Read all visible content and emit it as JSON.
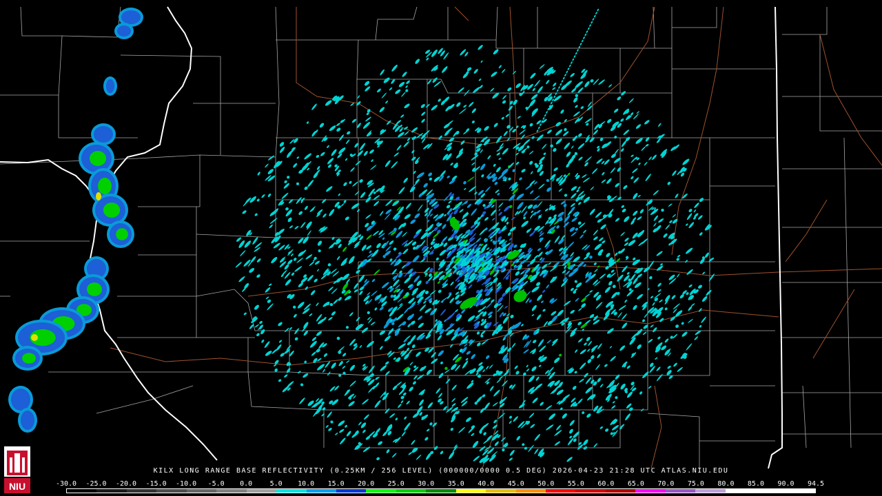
{
  "radar": {
    "station": "KILX",
    "title": "KILX LONG RANGE BASE REFLECTIVITY (0.25KM / 256 LEVEL) (000000/0000 0.5 DEG) 2026-04-23 21:28 UTC  ATLAS.NIU.EDU",
    "product": "Base Reflectivity",
    "elevation_deg": 0.5,
    "timestamp_utc": "2026-04-23 21:28"
  },
  "logo": {
    "text": "NIU",
    "colors": {
      "background": "#c8102e",
      "foreground": "#ffffff"
    }
  },
  "color_scale": {
    "labels": [
      "-30.0",
      "-25.0",
      "-20.0",
      "-15.0",
      "-10.0",
      "-5.0",
      "0.0",
      "5.0",
      "10.0",
      "15.0",
      "20.0",
      "25.0",
      "30.0",
      "35.0",
      "40.0",
      "45.0",
      "50.0",
      "55.0",
      "60.0",
      "65.0",
      "70.0",
      "75.0",
      "80.0",
      "85.0",
      "90.0",
      "94.5"
    ],
    "colors": [
      "#000000",
      "#1a1a1a",
      "#333333",
      "#4d4d4d",
      "#666666",
      "#808080",
      "#a0a0a0",
      "#00e4e4",
      "#00a0f0",
      "#0038d8",
      "#00ff00",
      "#00d000",
      "#008c00",
      "#ffff00",
      "#e7c000",
      "#ff9000",
      "#ff0000",
      "#d60000",
      "#b00000",
      "#ff00ff",
      "#9955c9",
      "#c0a0e0",
      "#ffffff",
      "#ffffff",
      "#ffffff"
    ]
  },
  "map_colors": {
    "background": "#000000",
    "state_border": "#ffffff",
    "county_border": "#a8a8a8",
    "highway": "#a0522d"
  }
}
